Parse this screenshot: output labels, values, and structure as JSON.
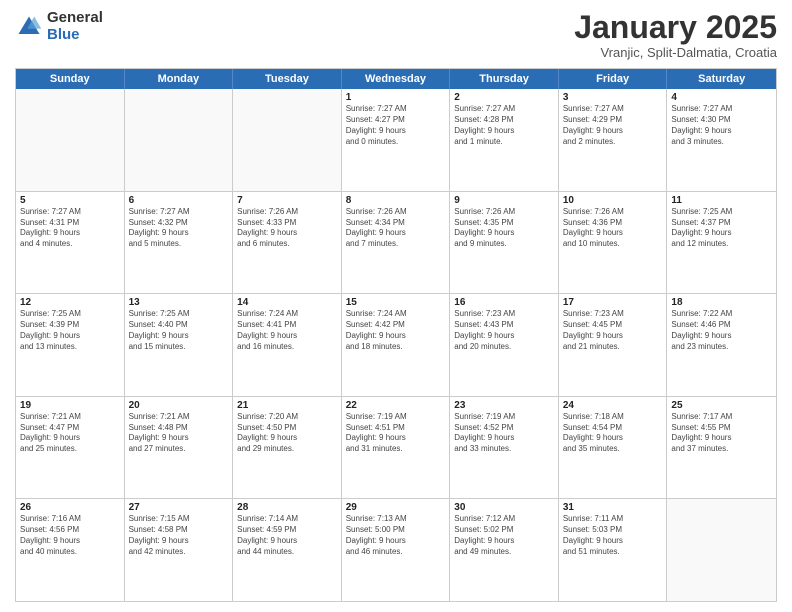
{
  "logo": {
    "general": "General",
    "blue": "Blue"
  },
  "title": "January 2025",
  "subtitle": "Vranjic, Split-Dalmatia, Croatia",
  "day_headers": [
    "Sunday",
    "Monday",
    "Tuesday",
    "Wednesday",
    "Thursday",
    "Friday",
    "Saturday"
  ],
  "weeks": [
    [
      {
        "num": "",
        "info": "",
        "empty": true
      },
      {
        "num": "",
        "info": "",
        "empty": true
      },
      {
        "num": "",
        "info": "",
        "empty": true
      },
      {
        "num": "1",
        "info": "Sunrise: 7:27 AM\nSunset: 4:27 PM\nDaylight: 9 hours\nand 0 minutes."
      },
      {
        "num": "2",
        "info": "Sunrise: 7:27 AM\nSunset: 4:28 PM\nDaylight: 9 hours\nand 1 minute."
      },
      {
        "num": "3",
        "info": "Sunrise: 7:27 AM\nSunset: 4:29 PM\nDaylight: 9 hours\nand 2 minutes."
      },
      {
        "num": "4",
        "info": "Sunrise: 7:27 AM\nSunset: 4:30 PM\nDaylight: 9 hours\nand 3 minutes."
      }
    ],
    [
      {
        "num": "5",
        "info": "Sunrise: 7:27 AM\nSunset: 4:31 PM\nDaylight: 9 hours\nand 4 minutes."
      },
      {
        "num": "6",
        "info": "Sunrise: 7:27 AM\nSunset: 4:32 PM\nDaylight: 9 hours\nand 5 minutes."
      },
      {
        "num": "7",
        "info": "Sunrise: 7:26 AM\nSunset: 4:33 PM\nDaylight: 9 hours\nand 6 minutes."
      },
      {
        "num": "8",
        "info": "Sunrise: 7:26 AM\nSunset: 4:34 PM\nDaylight: 9 hours\nand 7 minutes."
      },
      {
        "num": "9",
        "info": "Sunrise: 7:26 AM\nSunset: 4:35 PM\nDaylight: 9 hours\nand 9 minutes."
      },
      {
        "num": "10",
        "info": "Sunrise: 7:26 AM\nSunset: 4:36 PM\nDaylight: 9 hours\nand 10 minutes."
      },
      {
        "num": "11",
        "info": "Sunrise: 7:25 AM\nSunset: 4:37 PM\nDaylight: 9 hours\nand 12 minutes."
      }
    ],
    [
      {
        "num": "12",
        "info": "Sunrise: 7:25 AM\nSunset: 4:39 PM\nDaylight: 9 hours\nand 13 minutes."
      },
      {
        "num": "13",
        "info": "Sunrise: 7:25 AM\nSunset: 4:40 PM\nDaylight: 9 hours\nand 15 minutes."
      },
      {
        "num": "14",
        "info": "Sunrise: 7:24 AM\nSunset: 4:41 PM\nDaylight: 9 hours\nand 16 minutes."
      },
      {
        "num": "15",
        "info": "Sunrise: 7:24 AM\nSunset: 4:42 PM\nDaylight: 9 hours\nand 18 minutes."
      },
      {
        "num": "16",
        "info": "Sunrise: 7:23 AM\nSunset: 4:43 PM\nDaylight: 9 hours\nand 20 minutes."
      },
      {
        "num": "17",
        "info": "Sunrise: 7:23 AM\nSunset: 4:45 PM\nDaylight: 9 hours\nand 21 minutes."
      },
      {
        "num": "18",
        "info": "Sunrise: 7:22 AM\nSunset: 4:46 PM\nDaylight: 9 hours\nand 23 minutes."
      }
    ],
    [
      {
        "num": "19",
        "info": "Sunrise: 7:21 AM\nSunset: 4:47 PM\nDaylight: 9 hours\nand 25 minutes."
      },
      {
        "num": "20",
        "info": "Sunrise: 7:21 AM\nSunset: 4:48 PM\nDaylight: 9 hours\nand 27 minutes."
      },
      {
        "num": "21",
        "info": "Sunrise: 7:20 AM\nSunset: 4:50 PM\nDaylight: 9 hours\nand 29 minutes."
      },
      {
        "num": "22",
        "info": "Sunrise: 7:19 AM\nSunset: 4:51 PM\nDaylight: 9 hours\nand 31 minutes."
      },
      {
        "num": "23",
        "info": "Sunrise: 7:19 AM\nSunset: 4:52 PM\nDaylight: 9 hours\nand 33 minutes."
      },
      {
        "num": "24",
        "info": "Sunrise: 7:18 AM\nSunset: 4:54 PM\nDaylight: 9 hours\nand 35 minutes."
      },
      {
        "num": "25",
        "info": "Sunrise: 7:17 AM\nSunset: 4:55 PM\nDaylight: 9 hours\nand 37 minutes."
      }
    ],
    [
      {
        "num": "26",
        "info": "Sunrise: 7:16 AM\nSunset: 4:56 PM\nDaylight: 9 hours\nand 40 minutes."
      },
      {
        "num": "27",
        "info": "Sunrise: 7:15 AM\nSunset: 4:58 PM\nDaylight: 9 hours\nand 42 minutes."
      },
      {
        "num": "28",
        "info": "Sunrise: 7:14 AM\nSunset: 4:59 PM\nDaylight: 9 hours\nand 44 minutes."
      },
      {
        "num": "29",
        "info": "Sunrise: 7:13 AM\nSunset: 5:00 PM\nDaylight: 9 hours\nand 46 minutes."
      },
      {
        "num": "30",
        "info": "Sunrise: 7:12 AM\nSunset: 5:02 PM\nDaylight: 9 hours\nand 49 minutes."
      },
      {
        "num": "31",
        "info": "Sunrise: 7:11 AM\nSunset: 5:03 PM\nDaylight: 9 hours\nand 51 minutes."
      },
      {
        "num": "",
        "info": "",
        "empty": true
      }
    ]
  ]
}
